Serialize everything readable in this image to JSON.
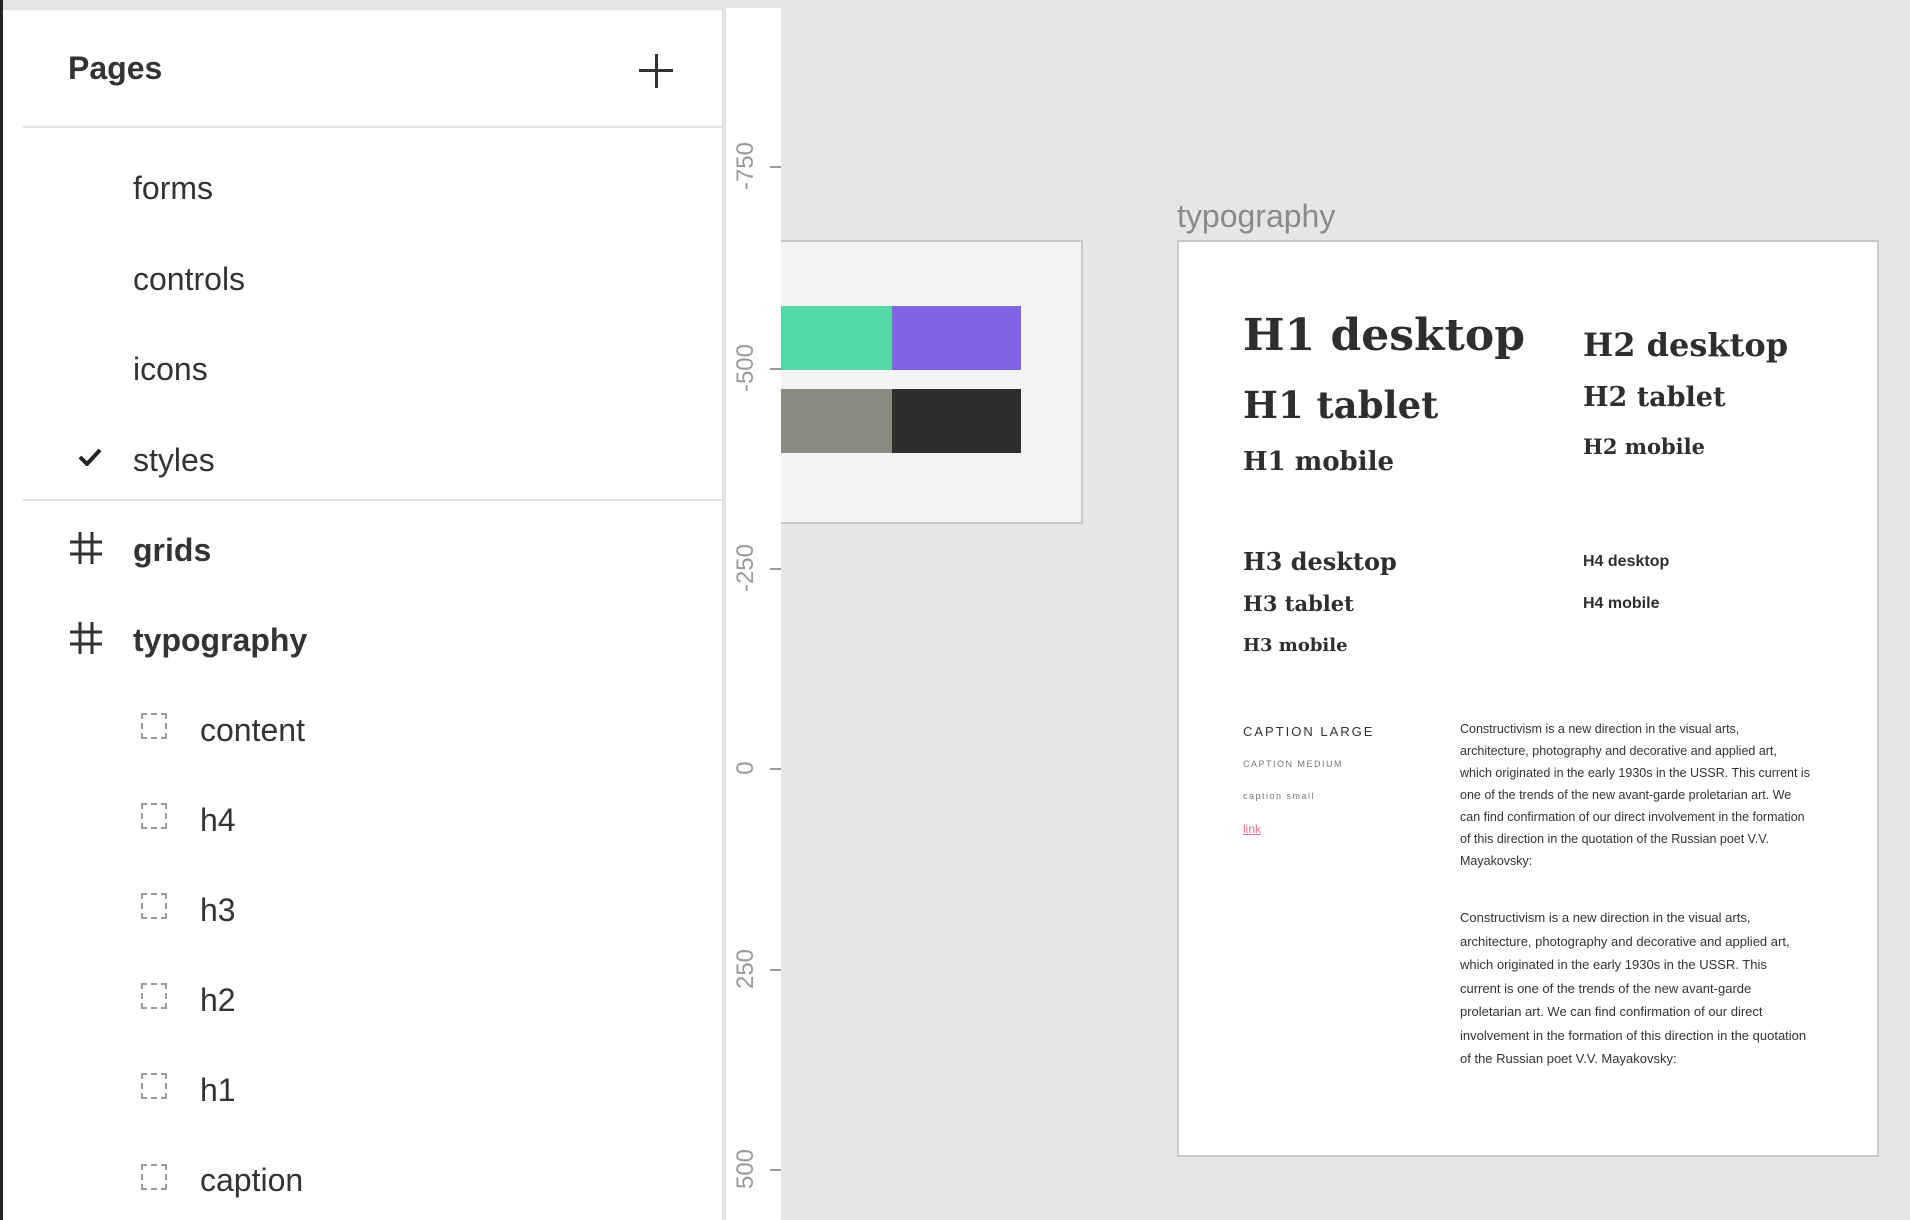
{
  "sidebar": {
    "title": "Pages",
    "add_label": "+",
    "pages": [
      {
        "label": "forms"
      },
      {
        "label": "controls"
      },
      {
        "label": "icons"
      },
      {
        "label": "styles",
        "selected": true
      }
    ],
    "layers": [
      {
        "label": "grids",
        "icon": "frame-hash-icon"
      },
      {
        "label": "typography",
        "icon": "frame-hash-icon"
      },
      {
        "label": "content",
        "icon": "group-dashed-icon"
      },
      {
        "label": "h4",
        "icon": "group-dashed-icon"
      },
      {
        "label": "h3",
        "icon": "group-dashed-icon"
      },
      {
        "label": "h2",
        "icon": "group-dashed-icon"
      },
      {
        "label": "h1",
        "icon": "group-dashed-icon"
      },
      {
        "label": "caption",
        "icon": "group-dashed-icon"
      }
    ]
  },
  "ruler": {
    "labels": [
      "-750",
      "-500",
      "-250",
      "0",
      "250",
      "500"
    ]
  },
  "canvas": {
    "palette_colors": [
      "#52d9a6",
      "#8262e6",
      "#8a8a82",
      "#2e2e2e"
    ],
    "frame_title": "typography",
    "headings": {
      "h1": [
        "H1 desktop",
        "H1 tablet",
        "H1 mobile"
      ],
      "h2": [
        "H2 desktop",
        "H2 tablet",
        "H2 mobile"
      ],
      "h3": [
        "H3 desktop",
        "H3 tablet",
        "H3 mobile"
      ],
      "h4": [
        "H4 desktop",
        "H4 mobile"
      ]
    },
    "captions": {
      "large": "CAPTION LARGE",
      "medium": "CAPTION MEDIUM",
      "small": "caption small",
      "link": "link"
    },
    "paragraph_1": "Constructivism is a new direction in the visual arts, architecture, photography and decorative and applied art, which originated in the early 1930s in the USSR. This current is one of the trends of the new avant-garde proletarian art. We can find confirmation of our direct involvement in the formation of this direction in the quotation of the Russian poet V.V. Mayakovsky:",
    "paragraph_2": "Constructivism is a new direction in the visual arts, architecture, photography and decorative and applied art, which originated in the early 1930s in the USSR. This current is one of the trends of the new avant-garde proletarian art. We can find confirmation of our direct involvement in the formation of this direction in the quotation of the Russian poet V.V. Mayakovsky:"
  }
}
